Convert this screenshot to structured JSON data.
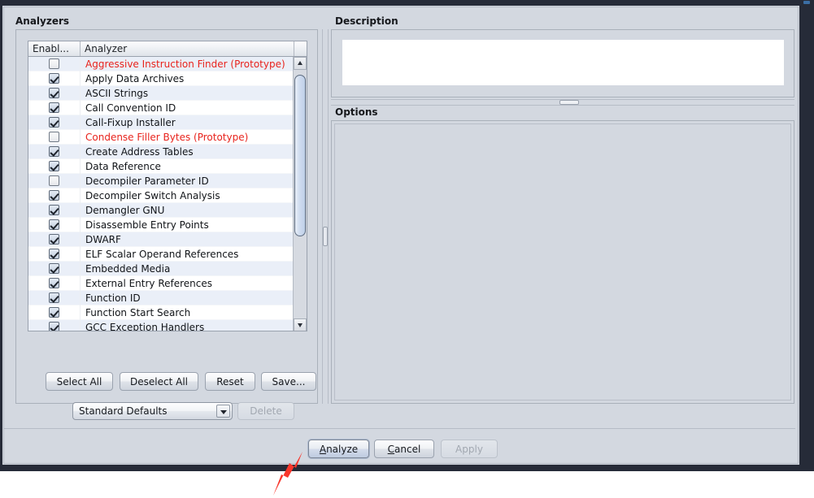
{
  "dialog": {
    "analyzers_panel_title": "Analyzers",
    "description_panel_title": "Description",
    "options_panel_title": "Options",
    "description_text": ""
  },
  "table": {
    "columns": [
      "Enabl...",
      "Analyzer"
    ],
    "rows": [
      {
        "enabled": false,
        "name": "Aggressive Instruction Finder (Prototype)",
        "prototype": true
      },
      {
        "enabled": true,
        "name": "Apply Data Archives",
        "prototype": false
      },
      {
        "enabled": true,
        "name": "ASCII Strings",
        "prototype": false
      },
      {
        "enabled": true,
        "name": "Call Convention ID",
        "prototype": false
      },
      {
        "enabled": true,
        "name": "Call-Fixup Installer",
        "prototype": false
      },
      {
        "enabled": false,
        "name": "Condense Filler Bytes (Prototype)",
        "prototype": true
      },
      {
        "enabled": true,
        "name": "Create Address Tables",
        "prototype": false
      },
      {
        "enabled": true,
        "name": "Data Reference",
        "prototype": false
      },
      {
        "enabled": false,
        "name": "Decompiler Parameter ID",
        "prototype": false
      },
      {
        "enabled": true,
        "name": "Decompiler Switch Analysis",
        "prototype": false
      },
      {
        "enabled": true,
        "name": "Demangler GNU",
        "prototype": false
      },
      {
        "enabled": true,
        "name": "Disassemble Entry Points",
        "prototype": false
      },
      {
        "enabled": true,
        "name": "DWARF",
        "prototype": false
      },
      {
        "enabled": true,
        "name": "ELF Scalar Operand References",
        "prototype": false
      },
      {
        "enabled": true,
        "name": "Embedded Media",
        "prototype": false
      },
      {
        "enabled": true,
        "name": "External Entry References",
        "prototype": false
      },
      {
        "enabled": true,
        "name": "Function ID",
        "prototype": false
      },
      {
        "enabled": true,
        "name": "Function Start Search",
        "prototype": false
      },
      {
        "enabled": true,
        "name": "GCC Exception Handlers",
        "prototype": false
      }
    ]
  },
  "left_buttons": {
    "select_all": "Select All",
    "deselect_all": "Deselect All",
    "reset": "Reset",
    "save": "Save..."
  },
  "preset_combo": {
    "selected": "Standard Defaults",
    "options": [
      "Standard Defaults"
    ]
  },
  "delete_button": {
    "label": "Delete",
    "enabled": false
  },
  "bottom_buttons": {
    "analyze": {
      "mnemonic": "A",
      "rest": "nalyze",
      "enabled": true,
      "default": true
    },
    "cancel": {
      "mnemonic": "C",
      "rest": "ancel",
      "enabled": true,
      "default": false
    },
    "apply": {
      "label": "Apply",
      "enabled": false
    }
  },
  "colors": {
    "dialog_background": "#d3d8e0",
    "window_chrome": "#262b38",
    "prototype_text": "#e8231c",
    "row_alt": "#eaeff8",
    "scrollbar_thumb": "#cfdcef",
    "annotation_arrow": "#f8362b",
    "default_button_highlight": "#bfcbe0"
  },
  "annotation": {
    "shape": "arrow",
    "points_to": "analyze-button"
  }
}
